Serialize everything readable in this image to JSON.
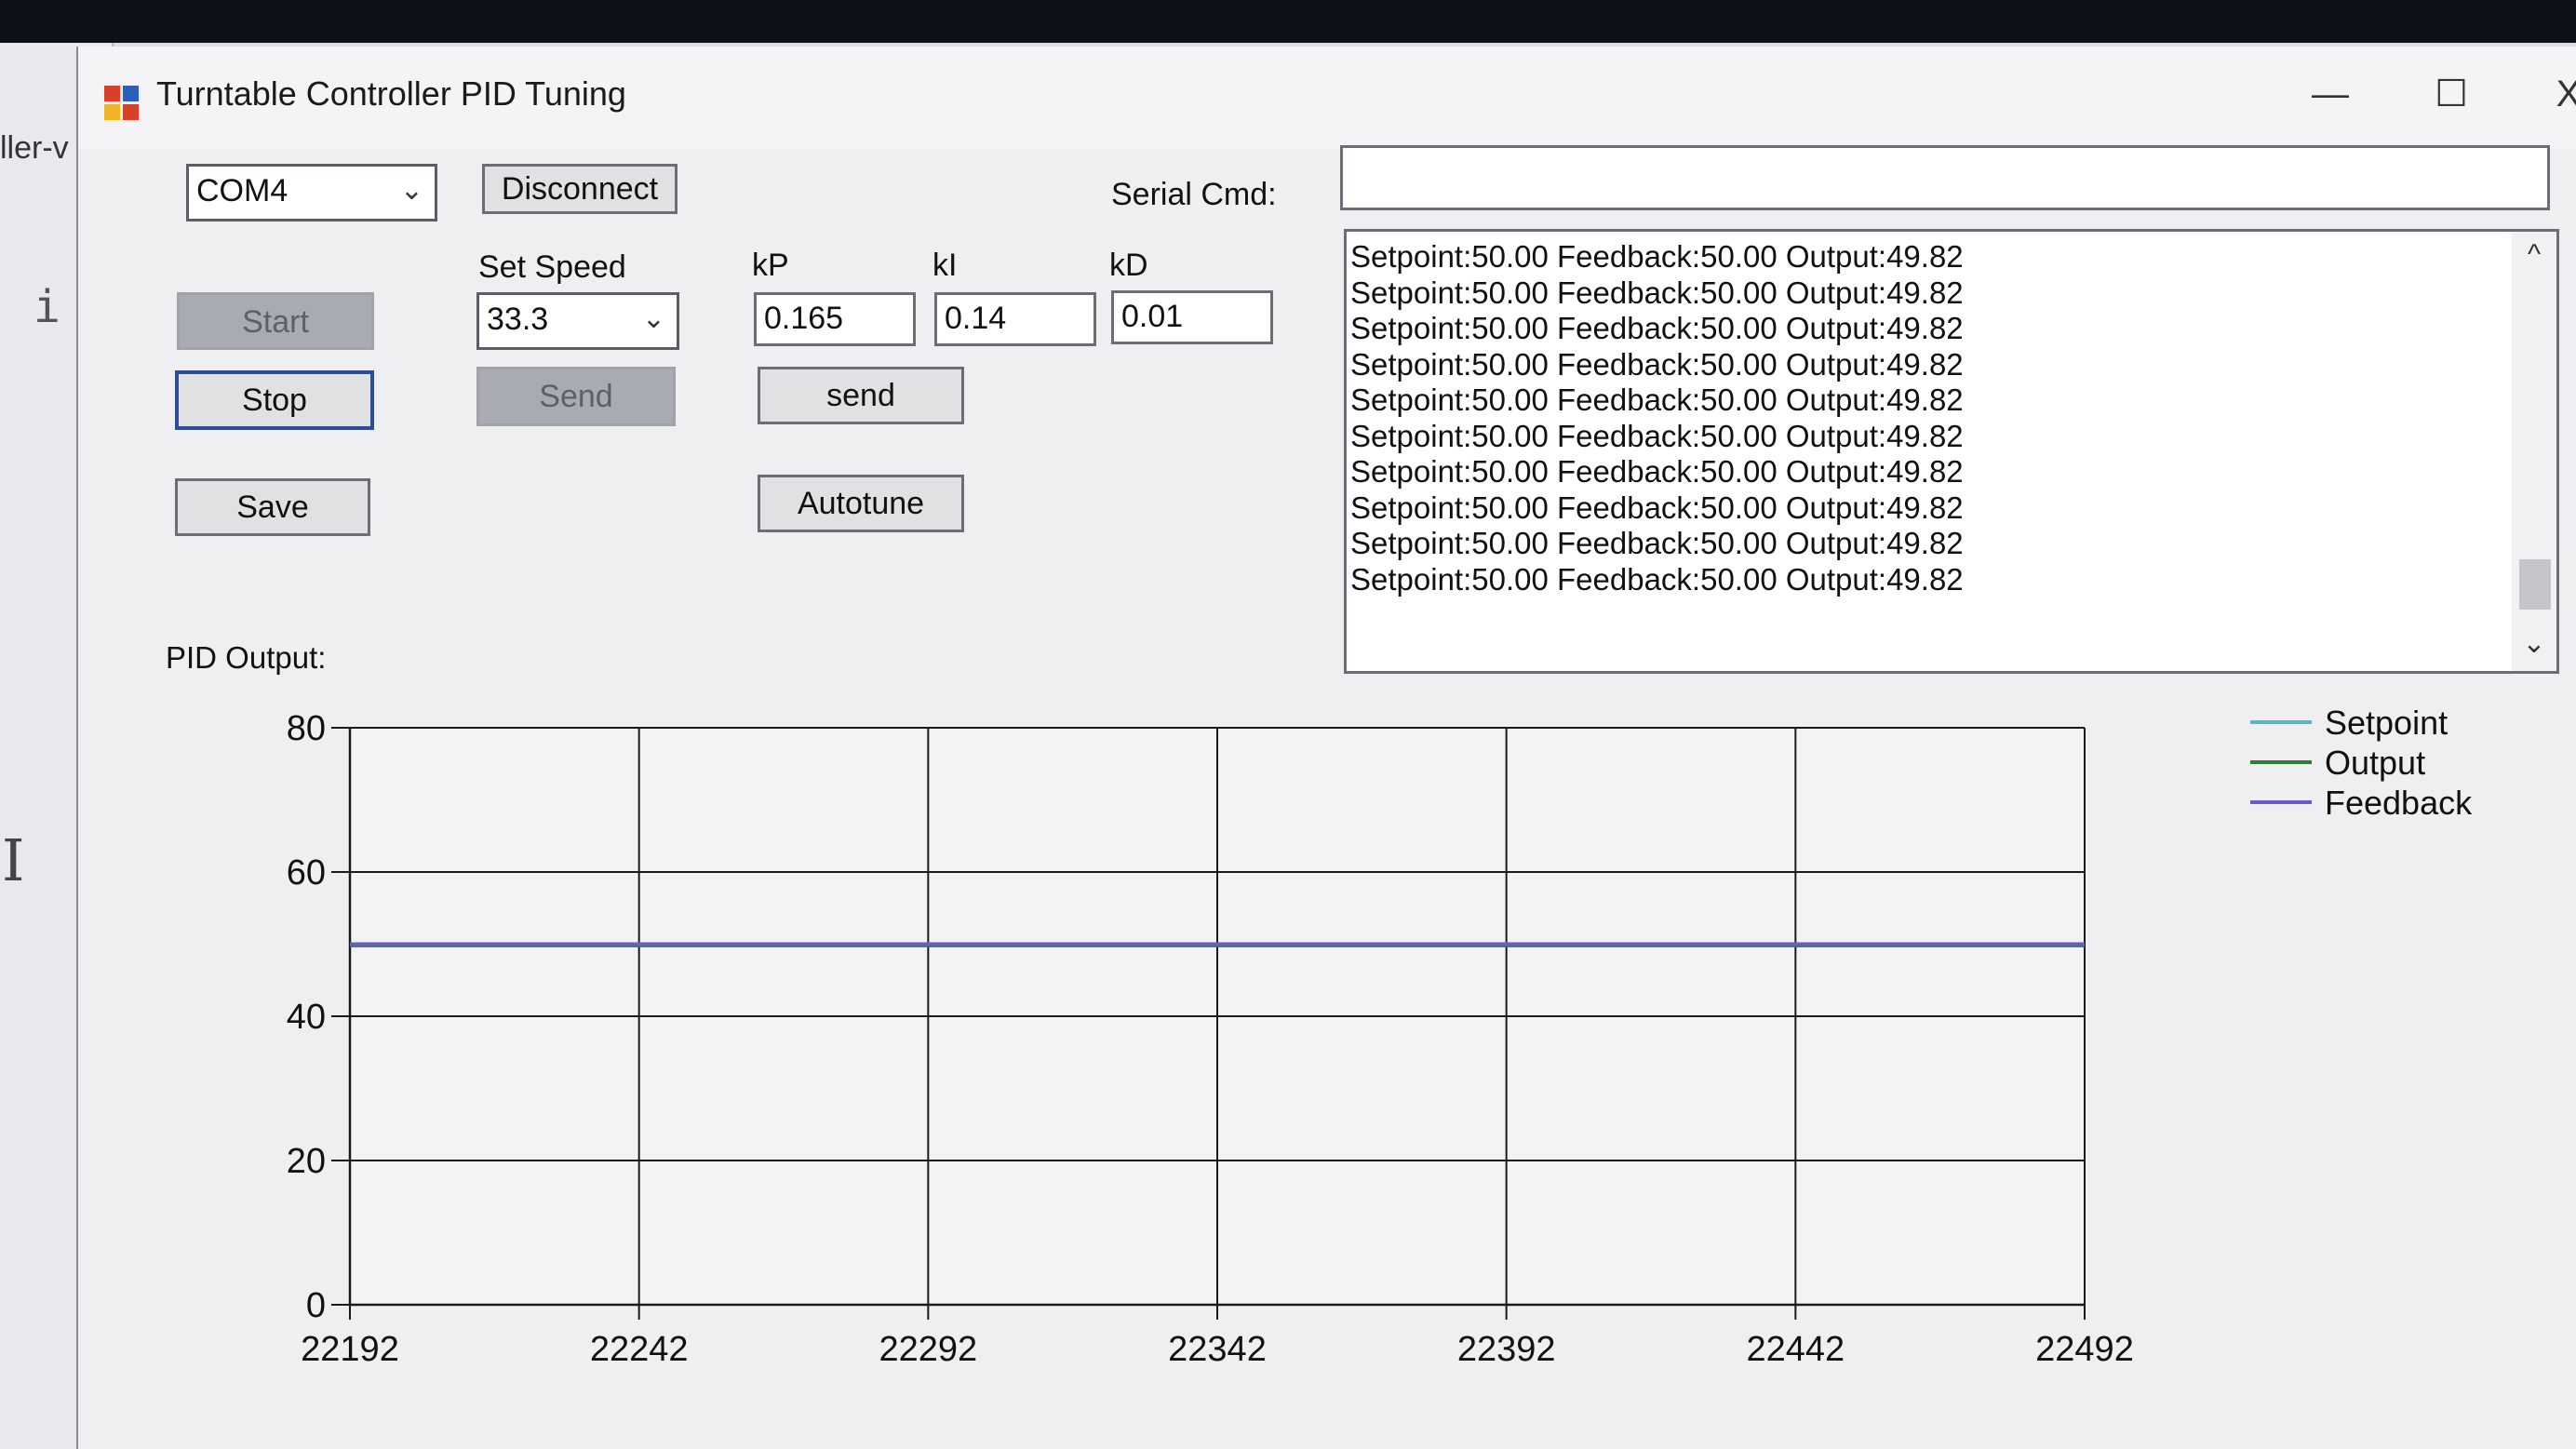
{
  "background": {
    "window_title_fragment": "ller-v",
    "side_text": "i",
    "cursor_glyph": "I"
  },
  "window": {
    "title": "Turntable Controller PID Tuning",
    "icon": "app-icon",
    "minimize_label": "—",
    "maximize_label": "☐",
    "close_label": "X"
  },
  "connection": {
    "port_value": "COM4",
    "disconnect_label": "Disconnect",
    "serial_cmd_label": "Serial Cmd:",
    "serial_cmd_value": ""
  },
  "controls": {
    "start_label": "Start",
    "stop_label": "Stop",
    "save_label": "Save",
    "set_speed_label": "Set Speed",
    "set_speed_value": "33.3",
    "speed_send_label": "Send",
    "kp_label": "kP",
    "kp_value": "0.165",
    "ki_label": "kI",
    "ki_value": "0.14",
    "kd_label": "kD",
    "kd_value": "0.01",
    "pid_send_label": "send",
    "autotune_label": "Autotune"
  },
  "log": {
    "lines": [
      "Setpoint:50.00 Feedback:50.00 Output:49.82",
      "Setpoint:50.00 Feedback:50.00 Output:49.82",
      "Setpoint:50.00 Feedback:50.00 Output:49.82",
      "Setpoint:50.00 Feedback:50.00 Output:49.82",
      "Setpoint:50.00 Feedback:50.00 Output:49.82",
      "Setpoint:50.00 Feedback:50.00 Output:49.82",
      "Setpoint:50.00 Feedback:50.00 Output:49.82",
      "Setpoint:50.00 Feedback:50.00 Output:49.82",
      "Setpoint:50.00 Feedback:50.00 Output:49.82",
      "Setpoint:50.00 Feedback:50.00 Output:49.82"
    ],
    "scroll_up": "^",
    "scroll_down": "⌄"
  },
  "chart_label": "PID Output:",
  "chart_data": {
    "type": "line",
    "title": "",
    "xlabel": "",
    "ylabel": "",
    "xlim": [
      22192,
      22492
    ],
    "ylim": [
      0,
      80
    ],
    "x_ticks": [
      "22192",
      "22242",
      "22292",
      "22342",
      "22392",
      "22442",
      "22492"
    ],
    "y_ticks": [
      "0",
      "20",
      "40",
      "60",
      "80"
    ],
    "grid": true,
    "legend_position": "top-right",
    "series": [
      {
        "name": "Setpoint",
        "color": "#5ab4c8",
        "x": [
          22192,
          22492
        ],
        "y": [
          50,
          50
        ]
      },
      {
        "name": "Output",
        "color": "#2e7d32",
        "x": [
          22192,
          22492
        ],
        "y": [
          49.82,
          49.82
        ]
      },
      {
        "name": "Feedback",
        "color": "#6a5acd",
        "x": [
          22192,
          22492
        ],
        "y": [
          50,
          50
        ]
      }
    ]
  }
}
